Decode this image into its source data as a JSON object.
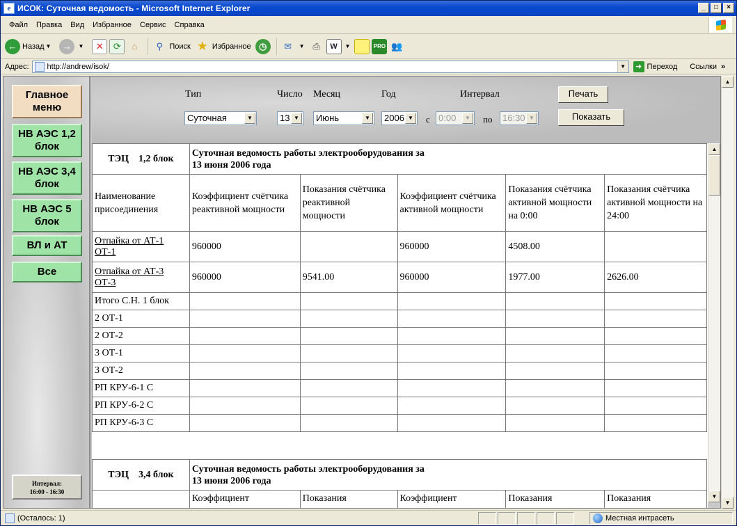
{
  "window": {
    "title": "ИСОК: Суточная ведомость - Microsoft Internet Explorer"
  },
  "menu": [
    "Файл",
    "Правка",
    "Вид",
    "Избранное",
    "Сервис",
    "Справка"
  ],
  "toolbar": {
    "back": "Назад",
    "search": "Поиск",
    "favorites": "Избранное"
  },
  "address": {
    "label": "Адрес:",
    "url": "http://andrew/isok/",
    "go": "Переход",
    "links": "Ссылки"
  },
  "nav": {
    "items": [
      "Главное меню",
      "НВ АЭС 1,2 блок",
      "НВ АЭС 3,4 блок",
      "НВ АЭС 5 блок",
      "ВЛ и АТ",
      "Все"
    ],
    "interval_label": "Интервал:",
    "interval_value": "16:00 - 16:30"
  },
  "controls": {
    "type_label": "Тип",
    "day_label": "Число",
    "month_label": "Месяц",
    "year_label": "Год",
    "interval_label": "Интервал",
    "type_value": "Суточная",
    "day_value": "13",
    "month_value": "Июнь",
    "year_value": "2006",
    "from_label": "с",
    "from_value": "0:00",
    "to_label": "по",
    "to_value": "16:30",
    "print_button": "Печать",
    "show_button": "Показать"
  },
  "report1": {
    "station": "ТЭЦ    1,2 блок",
    "title_line1": "Суточная ведомость работы электрооборудования за",
    "title_line2": "13 июня 2006 года",
    "columns": [
      "Наименование присоединения",
      "Коэффициент счётчика реактивной мощности",
      "Показания счётчика реактивной мощности",
      "Коэффициент счётчика активной мощности",
      "Показания счётчика активной мощности на 0:00",
      "Показания счётчика активной мощности на 24:00"
    ],
    "rows": [
      {
        "name": "Отпайка от АТ-1 ОТ-1",
        "k_react": "960000",
        "p_react": "",
        "k_act": "960000",
        "p_act0": "4508.00",
        "p_act24": ""
      },
      {
        "name": "Отпайка от АТ-3 ОТ-3",
        "k_react": "960000",
        "p_react": "9541.00",
        "k_act": "960000",
        "p_act0": "1977.00",
        "p_act24": "2626.00"
      },
      {
        "name": "Итого С.Н. 1 блок"
      },
      {
        "name": "2 ОТ-1"
      },
      {
        "name": "2 ОТ-2"
      },
      {
        "name": "3 ОТ-1"
      },
      {
        "name": "3 ОТ-2"
      },
      {
        "name": "РП КРУ-6-1 С"
      },
      {
        "name": "РП КРУ-6-2 С"
      },
      {
        "name": "РП КРУ-6-3 С"
      }
    ]
  },
  "report2": {
    "station": "ТЭЦ    3,4 блок",
    "title_line1": "Суточная ведомость работы электрооборудования за",
    "title_line2": "13 июня 2006 года",
    "columns": [
      "Коэффициент",
      "Показания",
      "Коэффициент",
      "Показания",
      "Показания"
    ]
  },
  "status": {
    "text": "(Осталось: 1)",
    "zone": "Местная интрасеть"
  }
}
